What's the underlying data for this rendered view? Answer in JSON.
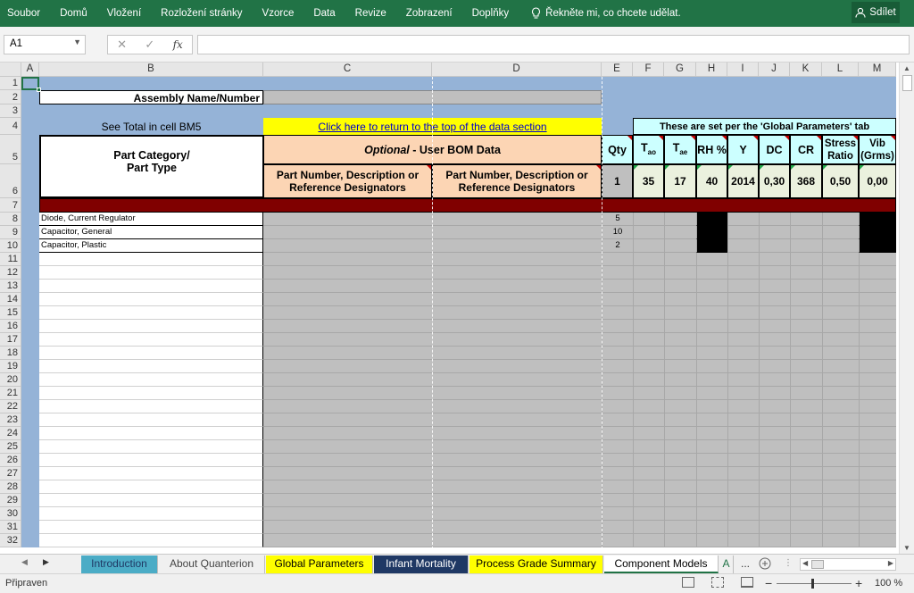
{
  "ribbon": {
    "tabs": [
      "Soubor",
      "Domů",
      "Vložení",
      "Rozložení stránky",
      "Vzorce",
      "Data",
      "Revize",
      "Zobrazení",
      "Doplňky"
    ],
    "tell_me": "Řekněte mi, co chcete udělat.",
    "share": "Sdílet"
  },
  "formula_bar": {
    "name_box": "A1",
    "cancel_glyph": "✕",
    "enter_glyph": "✓",
    "fx": "fx",
    "formula": ""
  },
  "columns": [
    "A",
    "B",
    "C",
    "D",
    "E",
    "F",
    "G",
    "H",
    "I",
    "J",
    "K",
    "L",
    "M"
  ],
  "rows": [
    "1",
    "2",
    "3",
    "4",
    "5",
    "6",
    "7",
    "8",
    "9",
    "10",
    "11",
    "12",
    "13",
    "14",
    "15",
    "16",
    "17",
    "18",
    "19",
    "20",
    "21",
    "22",
    "23",
    "24",
    "25",
    "26",
    "27",
    "28",
    "29",
    "30",
    "31",
    "32"
  ],
  "sheet": {
    "assembly_label": "Assembly Name/Number",
    "see_total": "See Total in cell BM5",
    "return_link": "Click here to return to the top of the data section",
    "global_note": "These are set per the 'Global Parameters' tab",
    "part_category": "Part Category/\nPart Type",
    "optional_em": "Optional",
    "optional_rest": " - User BOM Data",
    "part_number": "Part Number, Description or\nReference Designators",
    "params": {
      "qty": "Qty",
      "tao_main": "T",
      "tao_sub": "ao",
      "tae_main": "T",
      "tae_sub": "ae",
      "rh": "RH %",
      "y": "Y",
      "dc": "DC",
      "cr": "CR",
      "stress": "Stress\nRatio",
      "vib": "Vib\n(Grms)"
    },
    "param_values": {
      "qty": "1",
      "tao": "35",
      "tae": "17",
      "rh": "40",
      "y": "2014",
      "dc": "0,30",
      "cr": "368",
      "stress": "0,50",
      "vib": "0,00"
    },
    "parts": [
      {
        "name": "Diode, Current Regulator",
        "qty": "5"
      },
      {
        "name": "Capacitor, General",
        "qty": "10"
      },
      {
        "name": "Capacitor, Plastic",
        "qty": "2"
      }
    ]
  },
  "sheet_tabs": [
    {
      "label": "Introduction"
    },
    {
      "label": "About Quanterion"
    },
    {
      "label": "Global Parameters"
    },
    {
      "label": "Infant Mortality"
    },
    {
      "label": "Process Grade Summary"
    },
    {
      "label": "Component Models"
    },
    {
      "label": "A"
    },
    {
      "label": "..."
    }
  ],
  "status": {
    "ready": "Připraven",
    "zoom": "100 %"
  },
  "colors": {
    "ribbon": "#217346",
    "blue_bg": "#95B3D7",
    "gray_cell": "#BFBFBF",
    "peach": "#FCD5B4",
    "light_green": "#EBF1DE",
    "cyan": "#CCFFFF",
    "yellow": "#FFFF00",
    "maroon": "#800000",
    "tab_intro": "#4BACC6",
    "tab_yellow": "#FFFF00",
    "tab_navy": "#1F3864"
  }
}
